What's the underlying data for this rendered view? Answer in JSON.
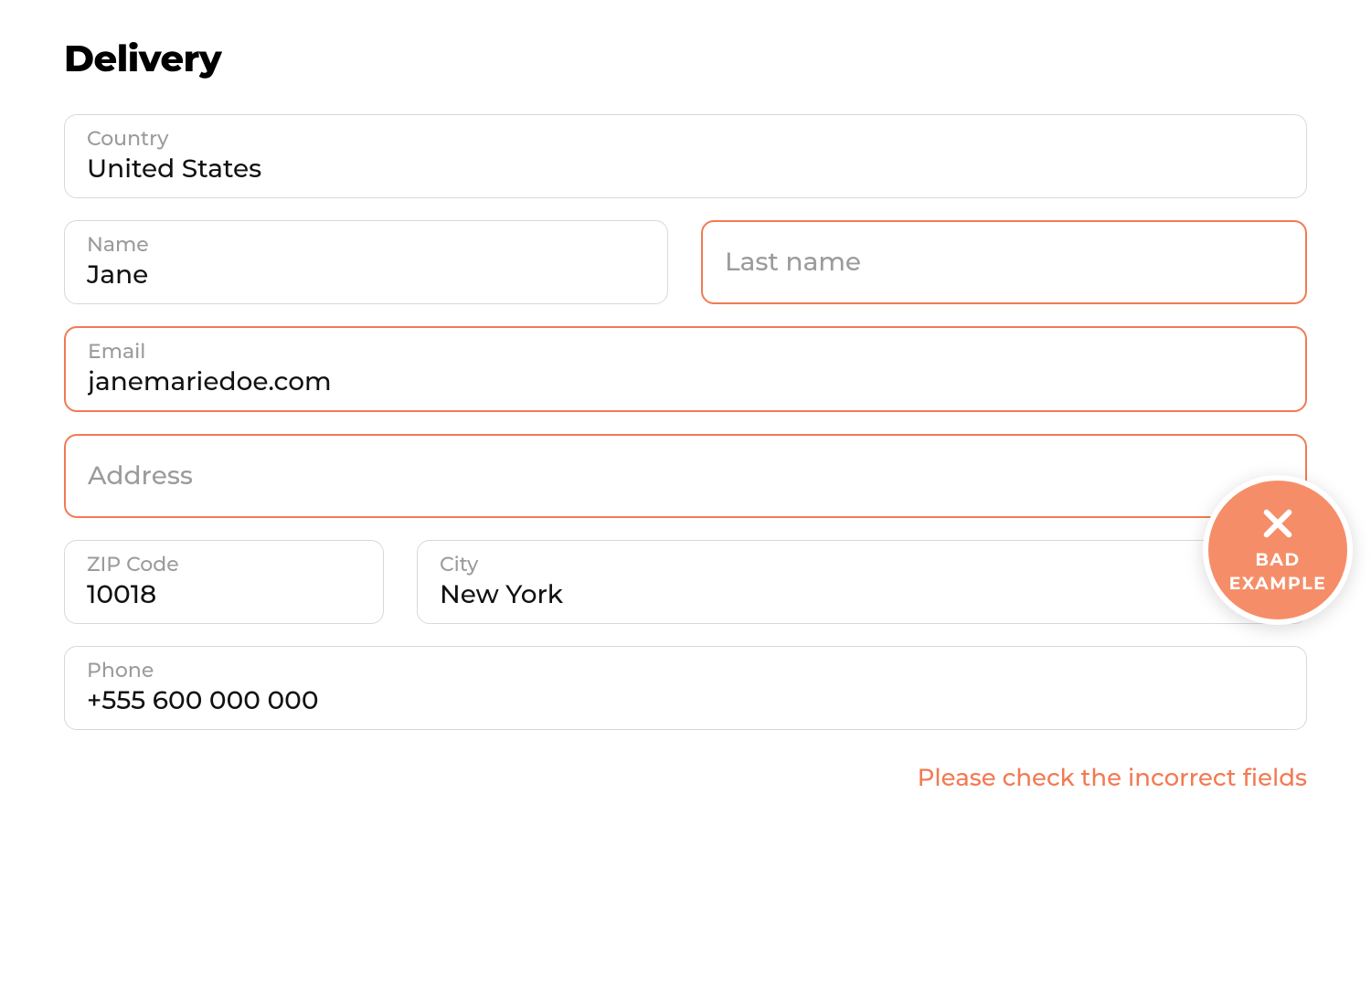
{
  "title": "Delivery",
  "fields": {
    "country": {
      "label": "Country",
      "value": "United States"
    },
    "name": {
      "label": "Name",
      "value": "Jane"
    },
    "lastname": {
      "placeholder": "Last name",
      "value": ""
    },
    "email": {
      "label": "Email",
      "value": "janemariedoe.com"
    },
    "address": {
      "placeholder": "Address",
      "value": ""
    },
    "zip": {
      "label": "ZIP Code",
      "value": "10018"
    },
    "city": {
      "label": "City",
      "value": "New York"
    },
    "phone": {
      "label": "Phone",
      "value": "+555 600 000 000"
    }
  },
  "error_message": "Please check the incorrect fields",
  "badge": {
    "line1": "BAD",
    "line2": "EXAMPLE"
  },
  "colors": {
    "error": "#f27a53",
    "badge": "#f58e68",
    "border": "#d8d8d8",
    "muted": "#9b9b9b"
  }
}
